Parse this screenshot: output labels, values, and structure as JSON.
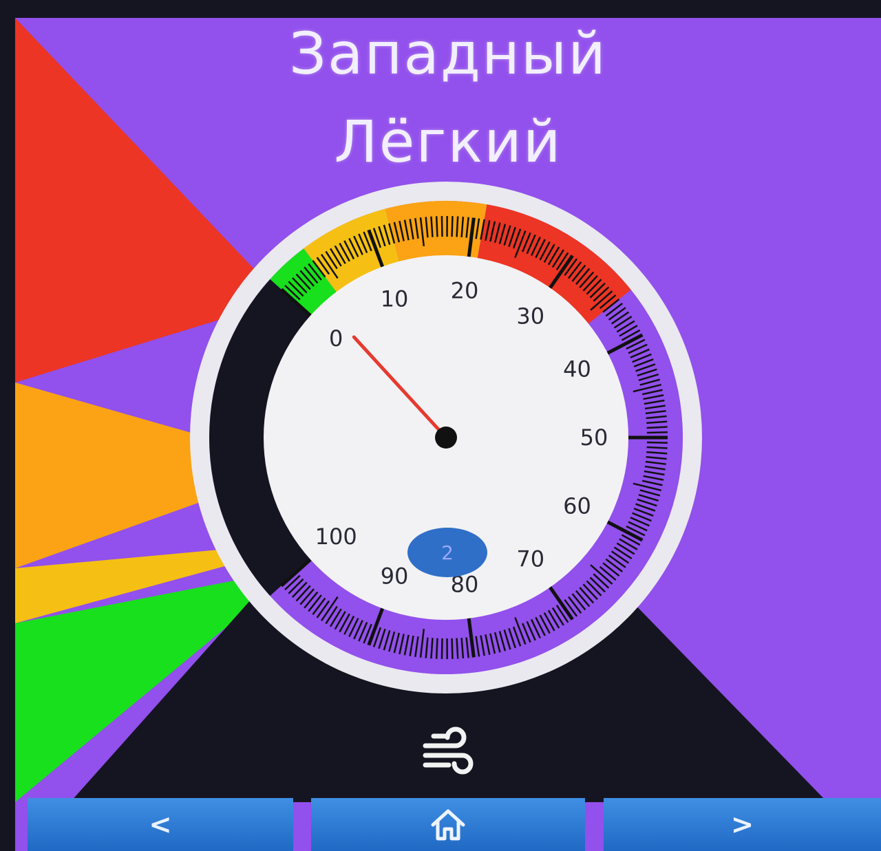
{
  "header": {
    "direction": "Западный",
    "strength": "Лёгкий"
  },
  "gauge": {
    "value": 2,
    "min": 0,
    "max": 100,
    "labels": [
      "0",
      "10",
      "20",
      "30",
      "40",
      "50",
      "60",
      "70",
      "80",
      "90",
      "100"
    ],
    "value_label": "2",
    "zones": [
      {
        "name": "green",
        "from": 0,
        "to": 4,
        "color": "#18e01c"
      },
      {
        "name": "yellow",
        "from": 4,
        "to": 12,
        "color": "#f5c013"
      },
      {
        "name": "orange",
        "from": 12,
        "to": 21,
        "color": "#fba314"
      },
      {
        "name": "red",
        "from": 21,
        "to": 36,
        "color": "#ec3524"
      },
      {
        "name": "purple",
        "from": 36,
        "to": 100,
        "color": "#9250ec"
      }
    ],
    "needle_color": "#e63a2e",
    "value_badge_color": "#2f6fc7"
  },
  "icons": {
    "wind": "wind-icon",
    "prev": "chevron-left-icon",
    "home": "home-icon",
    "next": "chevron-right-icon"
  },
  "nav": {
    "prev_label": "<",
    "next_label": ">"
  },
  "colors": {
    "background": "#9250ec",
    "bottom_panel": "#151521",
    "nav_button": "#2f7ad6"
  }
}
